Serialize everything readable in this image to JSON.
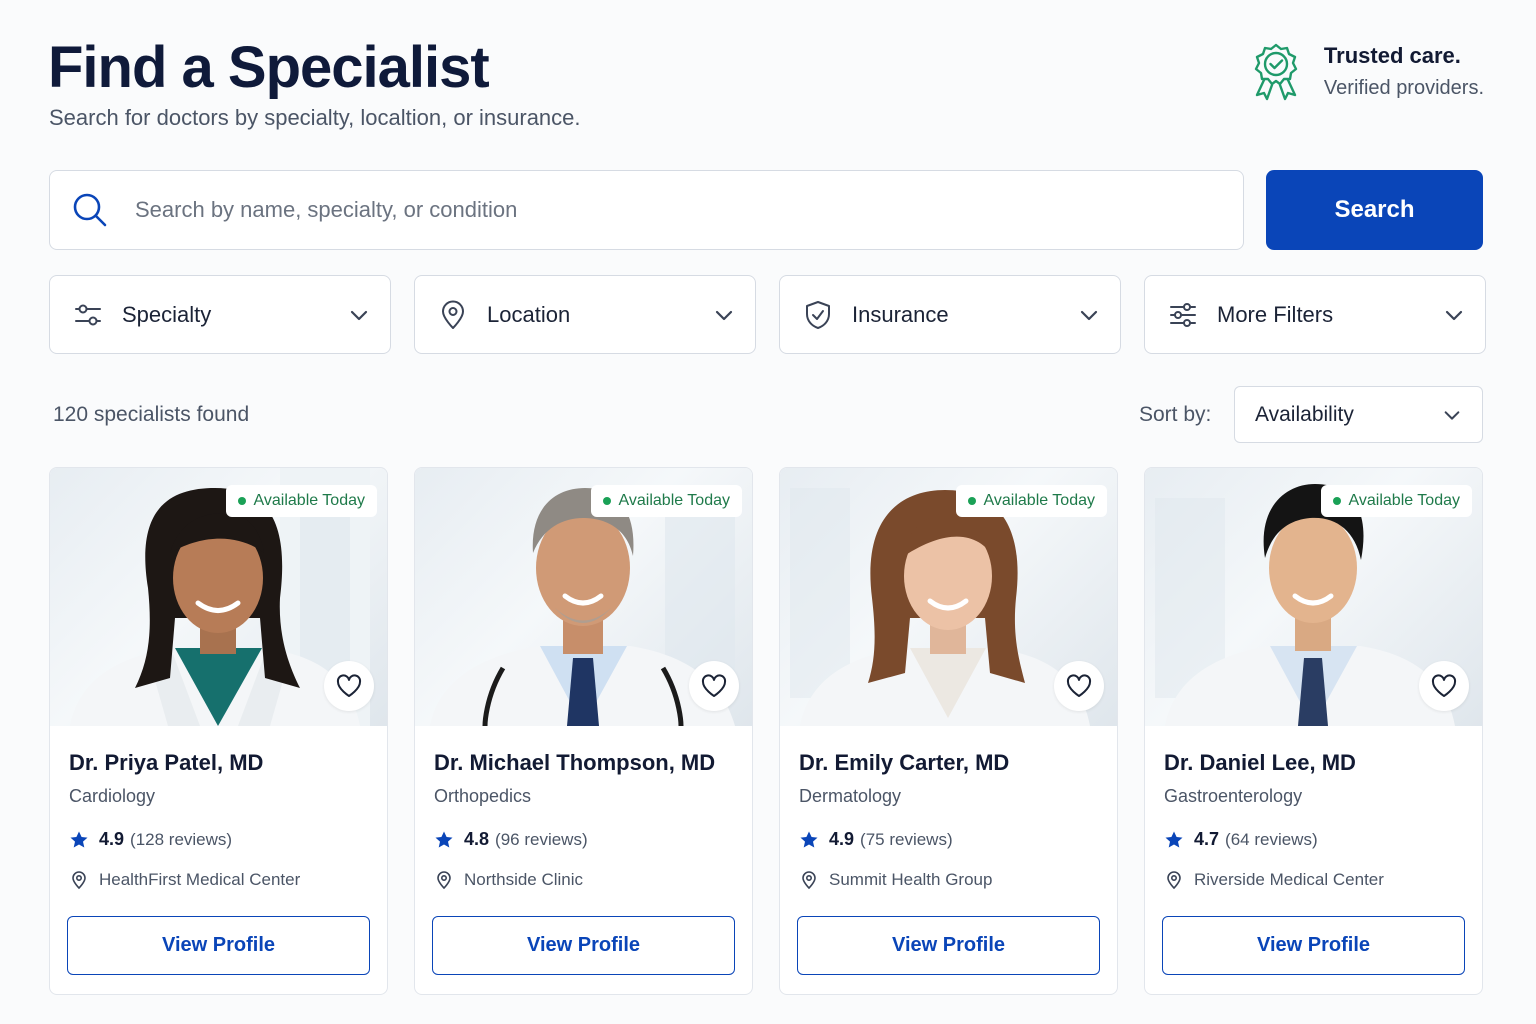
{
  "header": {
    "title": "Find a Specialist",
    "subtitle": "Search for doctors by specialty, localtion, or insurance.",
    "trust_line1": "Trusted care.",
    "trust_line2": "Verified providers.",
    "trust_icon": "award-ribbon-check-icon"
  },
  "search": {
    "placeholder": "Search by name, specialty, or condition",
    "value": "",
    "button_label": "Search"
  },
  "filters": [
    {
      "label": "Specialty",
      "icon": "sliders-icon"
    },
    {
      "label": "Location",
      "icon": "map-pin-icon"
    },
    {
      "label": "Insurance",
      "icon": "shield-check-icon"
    },
    {
      "label": "More Filters",
      "icon": "filters-icon"
    }
  ],
  "results": {
    "count_text": "120 specialists found",
    "sort_label": "Sort by:",
    "sort_value": "Availability"
  },
  "colors": {
    "primary": "#0a45b8",
    "available_green": "#1aa156",
    "trust_green": "#1f9a6a",
    "star": "#0a45b8"
  },
  "doctors": [
    {
      "name": "Dr. Priya Patel, MD",
      "specialty": "Cardiology",
      "rating": "4.9",
      "reviews": "(128 reviews)",
      "location": "HealthFirst Medical Center",
      "badge": "Available Today",
      "button": "View Profile"
    },
    {
      "name": "Dr. Michael Thompson, MD",
      "specialty": "Orthopedics",
      "rating": "4.8",
      "reviews": "(96 reviews)",
      "location": "Northside Clinic",
      "badge": "Available Today",
      "button": "View Profile"
    },
    {
      "name": "Dr. Emily Carter, MD",
      "specialty": "Dermatology",
      "rating": "4.9",
      "reviews": "(75 reviews)",
      "location": "Summit Health Group",
      "badge": "Available Today",
      "button": "View Profile"
    },
    {
      "name": "Dr. Daniel Lee, MD",
      "specialty": "Gastroenterology",
      "rating": "4.7",
      "reviews": "(64 reviews)",
      "location": "Riverside Medical Center",
      "badge": "Available Today",
      "button": "View Profile"
    }
  ]
}
